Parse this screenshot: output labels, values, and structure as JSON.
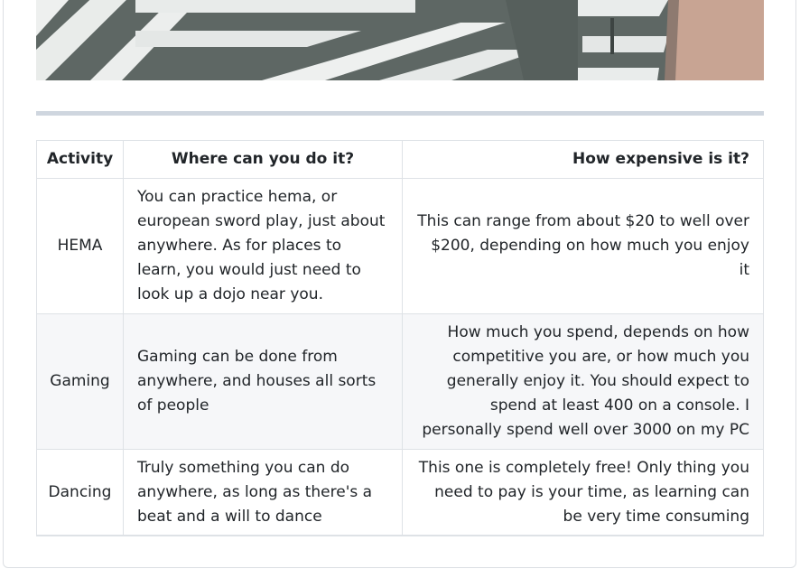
{
  "table": {
    "headers": {
      "activity": "Activity",
      "where": "Where can you do it?",
      "cost": "How expensive is it?"
    },
    "rows": [
      {
        "activity": "HEMA",
        "where": "You can practice hema, or european sword play, just about anywhere. As for places to learn, you would just need to look up a dojo near you.",
        "cost": "This can range from about $20 to well over $200, depending on how much you enjoy it"
      },
      {
        "activity": "Gaming",
        "where": "Gaming can be done from anywhere, and houses all sorts of people",
        "cost": "How much you spend, depends on how competitive you are, or how much you generally enjoy it. You should expect to spend at least 400 on a console. I personally spend well over 3000 on my PC"
      },
      {
        "activity": "Dancing",
        "where": "Truly something you can do anywhere, as long as there's a beat and a will to dance",
        "cost": "This one is completely free! Only thing you need to pay is your time, as learning can be very time consuming"
      }
    ]
  }
}
